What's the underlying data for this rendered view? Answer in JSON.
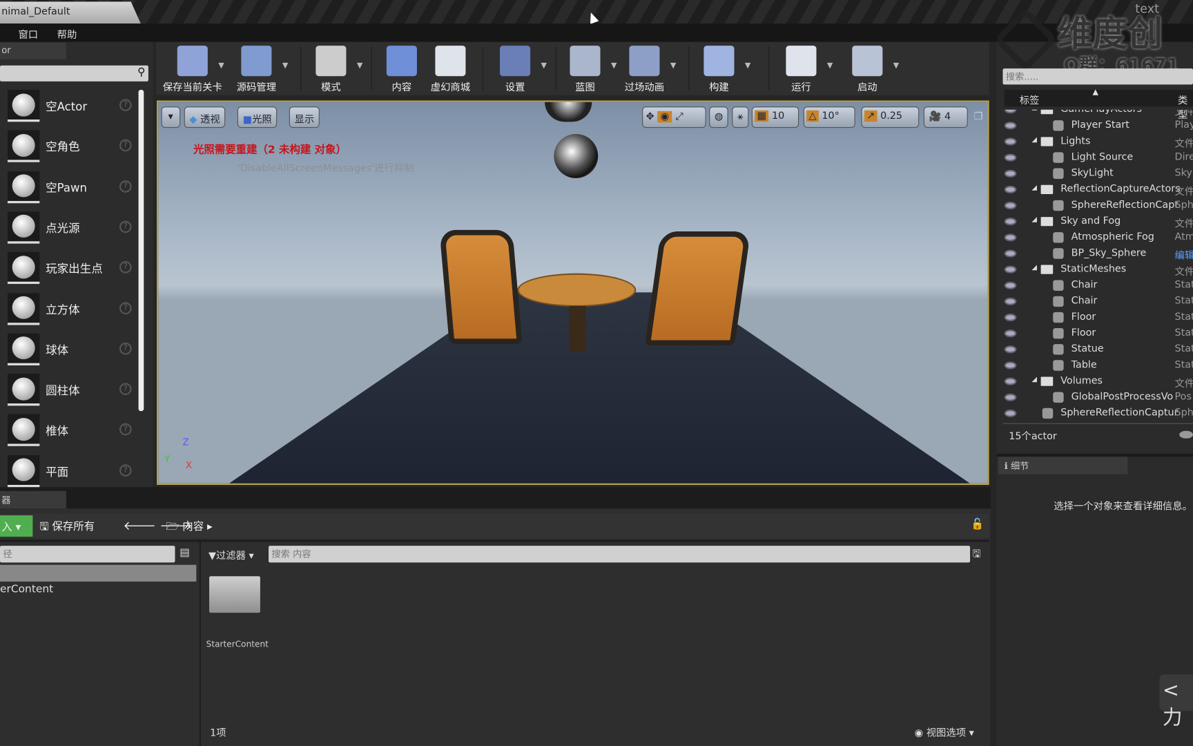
{
  "window": {
    "doc_tab": "nimal_Default"
  },
  "menu": [
    "窗口",
    "帮助"
  ],
  "place_panel": {
    "tab": "or",
    "items": [
      {
        "label": "空Actor",
        "icon": "sphere-icon"
      },
      {
        "label": "空角色",
        "icon": "character-icon"
      },
      {
        "label": "空Pawn",
        "icon": "pawn-icon"
      },
      {
        "label": "点光源",
        "icon": "bulb-icon"
      },
      {
        "label": "玩家出生点",
        "icon": "player-start-icon"
      },
      {
        "label": "立方体",
        "icon": "cube-icon"
      },
      {
        "label": "球体",
        "icon": "sphere-icon"
      },
      {
        "label": "圆柱体",
        "icon": "cylinder-icon"
      },
      {
        "label": "椎体",
        "icon": "cone-icon"
      },
      {
        "label": "平面",
        "icon": "plane-icon"
      }
    ],
    "help": "?"
  },
  "toolbar": [
    {
      "label": "保存当前关卡",
      "color": "#8fa3d9"
    },
    {
      "label": "源码管理",
      "color": "#7f9bd0"
    },
    {
      "label": "模式",
      "color": "#cccccc"
    },
    {
      "label": "内容",
      "color": "#6f8fd8"
    },
    {
      "label": "虚幻商城",
      "color": "#dfe3ea"
    },
    {
      "label": "设置",
      "color": "#6a7fb8"
    },
    {
      "label": "蓝图",
      "color": "#aab6cc"
    },
    {
      "label": "过场动画",
      "color": "#8d9fc6"
    },
    {
      "label": "构建",
      "color": "#9fb4e0"
    },
    {
      "label": "运行",
      "color": "#dfe4ec"
    },
    {
      "label": "启动",
      "color": "#b9c3d6"
    }
  ],
  "viewport": {
    "buttons": [
      "透视",
      "光照",
      "显示"
    ],
    "snap": {
      "grid": "10",
      "rotation": "10°",
      "scale": "0.25",
      "camera_speed": "4"
    },
    "warning": "光照需要重建（2 未构建 对象）",
    "hint": "'DisableAllScreenMessages'进行抑制",
    "axes": [
      "Z",
      "Y",
      "X"
    ]
  },
  "watermark": {
    "line1": "维度创",
    "line2": "Q群：61671",
    "badge": "text"
  },
  "outliner": {
    "search_placeholder": "搜索.....",
    "col_label": "标签",
    "col_type": "类型",
    "rows": [
      {
        "name": "GamePlayActors",
        "type": "文件",
        "level": 0,
        "folder": true
      },
      {
        "name": "Player Start",
        "type": "Play",
        "level": 1
      },
      {
        "name": "Lights",
        "type": "文件",
        "level": 0,
        "folder": true
      },
      {
        "name": "Light Source",
        "type": "Dire",
        "level": 1
      },
      {
        "name": "SkyLight",
        "type": "Sky",
        "level": 1
      },
      {
        "name": "ReflectionCaptureActors",
        "type": "文件",
        "level": 0,
        "folder": true
      },
      {
        "name": "SphereReflectionCapt",
        "type": "Sph",
        "level": 1
      },
      {
        "name": "Sky and Fog",
        "type": "文件",
        "level": 0,
        "folder": true
      },
      {
        "name": "Atmospheric Fog",
        "type": "Atm",
        "level": 1
      },
      {
        "name": "BP_Sky_Sphere",
        "type": "编辑",
        "level": 1,
        "link": true
      },
      {
        "name": "StaticMeshes",
        "type": "文件",
        "level": 0,
        "folder": true
      },
      {
        "name": "Chair",
        "type": "Stat",
        "level": 1
      },
      {
        "name": "Chair",
        "type": "Stat",
        "level": 1
      },
      {
        "name": "Floor",
        "type": "Stat",
        "level": 1
      },
      {
        "name": "Floor",
        "type": "Stat",
        "level": 1
      },
      {
        "name": "Statue",
        "type": "Stat",
        "level": 1
      },
      {
        "name": "Table",
        "type": "Stat",
        "level": 1
      },
      {
        "name": "Volumes",
        "type": "文件",
        "level": 0,
        "folder": true
      },
      {
        "name": "GlobalPostProcessVo",
        "type": "Pos",
        "level": 1
      },
      {
        "name": "SphereReflectionCaptur",
        "type": "Sph",
        "level": 0
      }
    ],
    "count": "15个actor"
  },
  "details": {
    "tab": "细节",
    "empty": "选择一个对象来查看详细信息。"
  },
  "content_browser": {
    "tab": "器",
    "import": "入",
    "save_all": "保存所有",
    "path": "内容",
    "tree_search": "径",
    "tree_item": "erContent",
    "filter": "过滤器",
    "search_placeholder": "搜索 内容",
    "asset": "StarterContent",
    "count": "1项",
    "view_options": "视图选项"
  },
  "side_text": "<力"
}
